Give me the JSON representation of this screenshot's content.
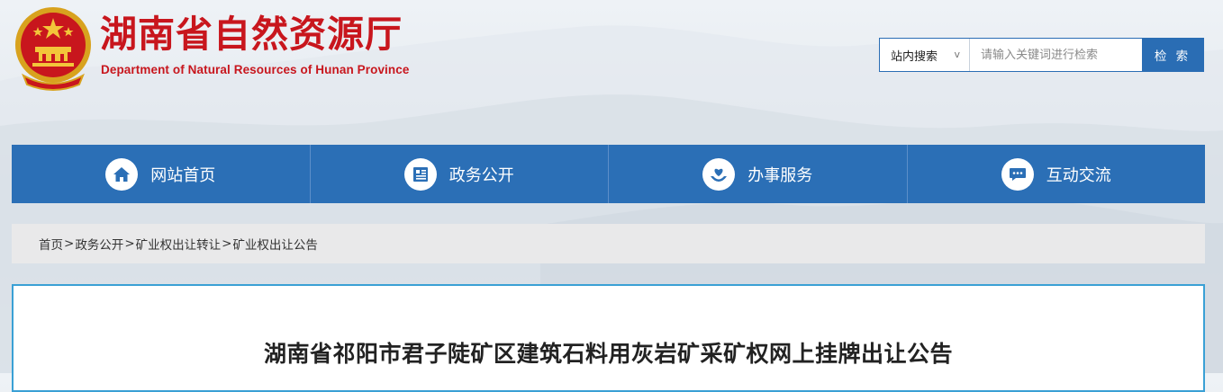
{
  "header": {
    "title": "湖南省自然资源厅",
    "subtitle": "Department of Natural Resources of Hunan Province",
    "emblem_icon": "national-emblem-icon"
  },
  "search": {
    "scope_label": "站内搜索",
    "placeholder": "请输入关键词进行检索",
    "button_label": "检 索"
  },
  "nav": {
    "items": [
      {
        "label": "网站首页",
        "icon": "home-icon"
      },
      {
        "label": "政务公开",
        "icon": "document-icon"
      },
      {
        "label": "办事服务",
        "icon": "heart-hands-icon"
      },
      {
        "label": "互动交流",
        "icon": "chat-icon"
      }
    ]
  },
  "breadcrumb": {
    "items": [
      "首页",
      "政务公开",
      "矿业权出让转让",
      "矿业权出让公告"
    ],
    "separator": ">"
  },
  "article": {
    "title": "湖南省祁阳市君子陡矿区建筑石料用灰岩矿采矿权网上挂牌出让公告"
  },
  "colors": {
    "brand_red": "#c8161d",
    "nav_blue": "#2b6fb6",
    "frame_cyan": "#3aa0d5",
    "breadcrumb_bg": "#e9e9ea"
  }
}
